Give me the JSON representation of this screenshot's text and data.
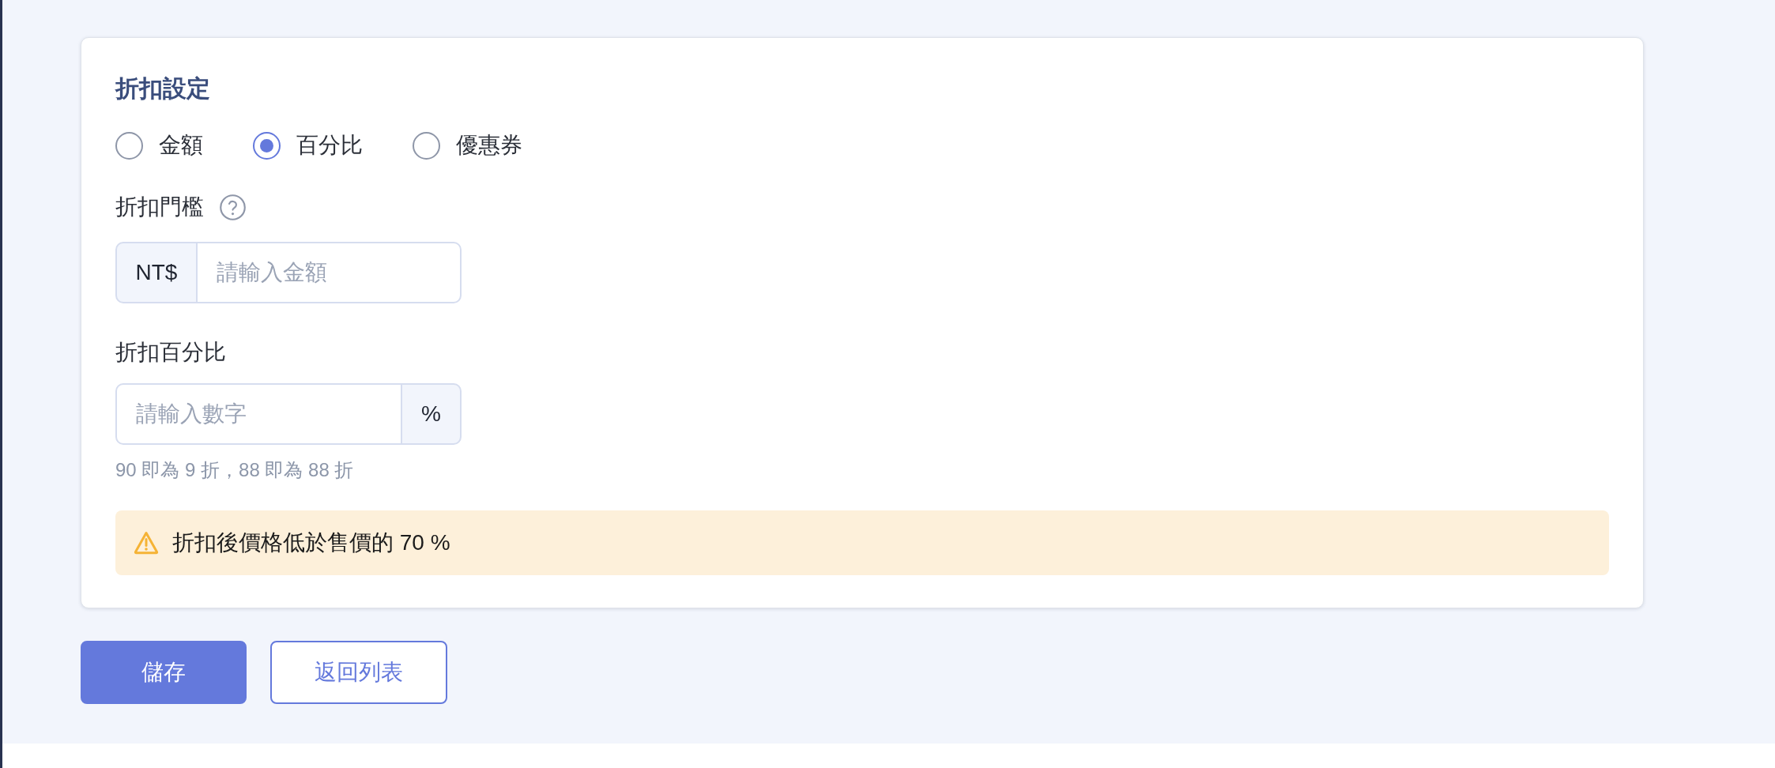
{
  "section": {
    "title": "折扣設定"
  },
  "discount_type": [
    {
      "label": "金額",
      "selected": false
    },
    {
      "label": "百分比",
      "selected": true
    },
    {
      "label": "優惠券",
      "selected": false
    }
  ],
  "threshold": {
    "label": "折扣門檻",
    "prefix": "NT$",
    "placeholder": "請輸入金額"
  },
  "percentage": {
    "label": "折扣百分比",
    "placeholder": "請輸入數字",
    "suffix": "%",
    "hint": "90 即為 9 折，88 即為 88 折"
  },
  "warning": {
    "text": "折扣後價格低於售價的 70 %"
  },
  "buttons": [
    {
      "label": "儲存",
      "kind": "primary"
    },
    {
      "label": "返回列表",
      "kind": "secondary"
    }
  ]
}
